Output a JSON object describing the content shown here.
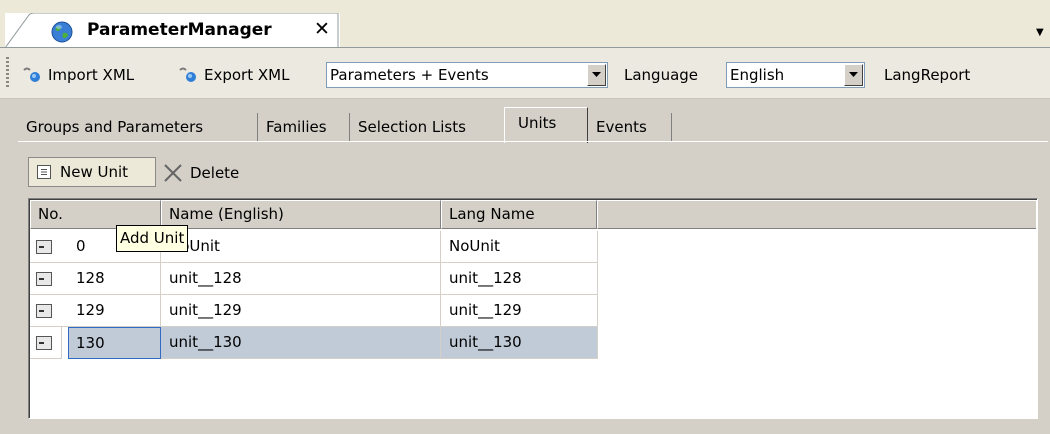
{
  "doc_tab": {
    "title": "ParameterManager",
    "close": "x",
    "icon": "globe-icon"
  },
  "toolbar": {
    "import_label": "Import XML",
    "export_label": "Export XML",
    "filter_value": "Parameters + Events",
    "language_label": "Language",
    "language_value": "English",
    "langreport_label": "LangReport"
  },
  "tabs": [
    {
      "label": "Groups and Parameters",
      "active": false
    },
    {
      "label": "Families",
      "active": false
    },
    {
      "label": "Selection Lists",
      "active": false
    },
    {
      "label": "Units",
      "active": true
    },
    {
      "label": "Events",
      "active": false
    }
  ],
  "panel": {
    "new_unit_label": "New Unit",
    "delete_label": "Delete"
  },
  "grid": {
    "columns": [
      "No.",
      "Name (English)",
      "Lang Name"
    ],
    "rows": [
      {
        "no": "0",
        "name": "NoUnit",
        "lang": "NoUnit",
        "selected": false
      },
      {
        "no": "128",
        "name": "unit__128",
        "lang": "unit__128",
        "selected": false
      },
      {
        "no": "129",
        "name": "unit__129",
        "lang": "unit__129",
        "selected": false
      },
      {
        "no": "130",
        "name": "unit__130",
        "lang": "unit__130",
        "selected": true
      }
    ]
  },
  "tooltip": "Add Unit",
  "colors": {
    "selection": "#c1cad7",
    "tooltip_bg": "#ffffe1",
    "face": "#d4d0c8"
  }
}
